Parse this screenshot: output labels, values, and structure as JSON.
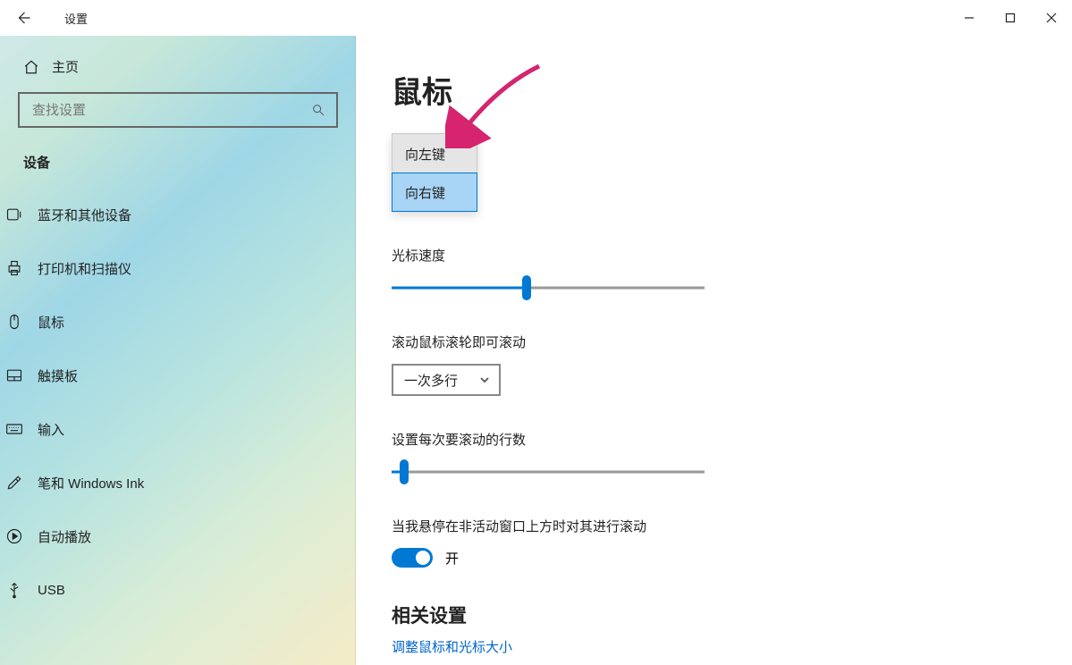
{
  "window": {
    "title": "设置"
  },
  "sidebar": {
    "home": "主页",
    "search_placeholder": "查找设置",
    "category": "设备",
    "items": [
      {
        "label": "蓝牙和其他设备",
        "icon": "bluetooth"
      },
      {
        "label": "打印机和扫描仪",
        "icon": "printer"
      },
      {
        "label": "鼠标",
        "icon": "mouse",
        "active": true
      },
      {
        "label": "触摸板",
        "icon": "touchpad"
      },
      {
        "label": "输入",
        "icon": "keyboard"
      },
      {
        "label": "笔和 Windows Ink",
        "icon": "pen"
      },
      {
        "label": "自动播放",
        "icon": "autoplay"
      },
      {
        "label": "USB",
        "icon": "usb"
      }
    ]
  },
  "main": {
    "title": "鼠标",
    "primary_button_dropdown": {
      "options": [
        "向左键",
        "向右键"
      ],
      "selected": "向右键"
    },
    "cursor_speed": {
      "label": "光标速度",
      "value": 43
    },
    "scroll_wheel": {
      "label": "滚动鼠标滚轮即可滚动",
      "combo_value": "一次多行"
    },
    "lines_per_scroll": {
      "label": "设置每次要滚动的行数",
      "value": 4
    },
    "hover_scroll": {
      "label": "当我悬停在非活动窗口上方时对其进行滚动",
      "toggle_text": "开",
      "on": true
    },
    "related": {
      "heading": "相关设置",
      "link": "调整鼠标和光标大小"
    }
  }
}
